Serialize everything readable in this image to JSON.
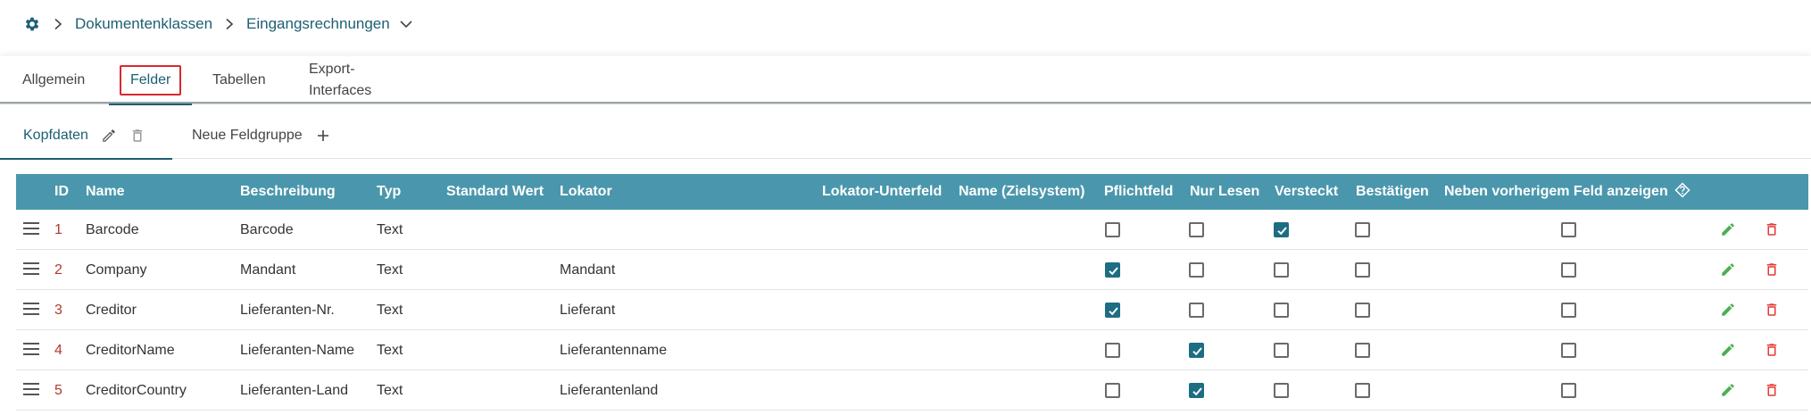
{
  "breadcrumb": {
    "items": [
      "Dokumentenklassen",
      "Eingangsrechnungen"
    ]
  },
  "top_tabs": [
    "Allgemein",
    "Felder",
    "Tabellen",
    "Export-Interfaces"
  ],
  "active_top_tab": "Felder",
  "field_groups": {
    "active": "Kopfdaten",
    "new_label": "Neue Feldgruppe"
  },
  "table": {
    "columns": [
      "ID",
      "Name",
      "Beschreibung",
      "Typ",
      "Standard Wert",
      "Lokator",
      "Lokator-Unterfeld",
      "Name (Zielsystem)",
      "Pflichtfeld",
      "Nur Lesen",
      "Versteckt",
      "Bestätigen",
      "Neben vorherigem Feld anzeigen"
    ],
    "rows": [
      {
        "id": "1",
        "name": "Barcode",
        "beschreibung": "Barcode",
        "typ": "Text",
        "standard": "",
        "lokator": "",
        "pflichtfeld": false,
        "nur_lesen": false,
        "versteckt": true,
        "bestaetigen": false,
        "neben": false
      },
      {
        "id": "2",
        "name": "Company",
        "beschreibung": "Mandant",
        "typ": "Text",
        "standard": "",
        "lokator": "Mandant",
        "pflichtfeld": true,
        "nur_lesen": false,
        "versteckt": false,
        "bestaetigen": false,
        "neben": false
      },
      {
        "id": "3",
        "name": "Creditor",
        "beschreibung": "Lieferanten-Nr.",
        "typ": "Text",
        "standard": "",
        "lokator": "Lieferant",
        "pflichtfeld": true,
        "nur_lesen": false,
        "versteckt": false,
        "bestaetigen": false,
        "neben": false
      },
      {
        "id": "4",
        "name": "CreditorName",
        "beschreibung": "Lieferanten-Name",
        "typ": "Text",
        "standard": "",
        "lokator": "Lieferantenname",
        "pflichtfeld": false,
        "nur_lesen": true,
        "versteckt": false,
        "bestaetigen": false,
        "neben": false
      },
      {
        "id": "5",
        "name": "CreditorCountry",
        "beschreibung": "Lieferanten-Land",
        "typ": "Text",
        "standard": "",
        "lokator": "Lieferantenland",
        "pflichtfeld": false,
        "nur_lesen": true,
        "versteckt": false,
        "bestaetigen": false,
        "neben": false
      }
    ]
  },
  "colors": {
    "accent": "#1d5f73",
    "header_bg": "#4a97ad",
    "checkbox_checked": "#1d6d83",
    "edit_icon": "#4caf50",
    "delete_icon": "#e53935",
    "highlight_border": "#d9272e"
  },
  "icons": {
    "breadcrumb_root": "gear-icon",
    "breadcrumb_separator": "chevron-right-icon",
    "breadcrumb_dropdown": "chevron-down-icon",
    "group_edit": "pencil-icon",
    "group_delete": "trash-icon",
    "group_add": "plus-icon",
    "help": "question-diamond-icon",
    "row_drag": "drag-handle-icon",
    "row_edit": "pencil-icon",
    "row_delete": "trash-icon"
  }
}
